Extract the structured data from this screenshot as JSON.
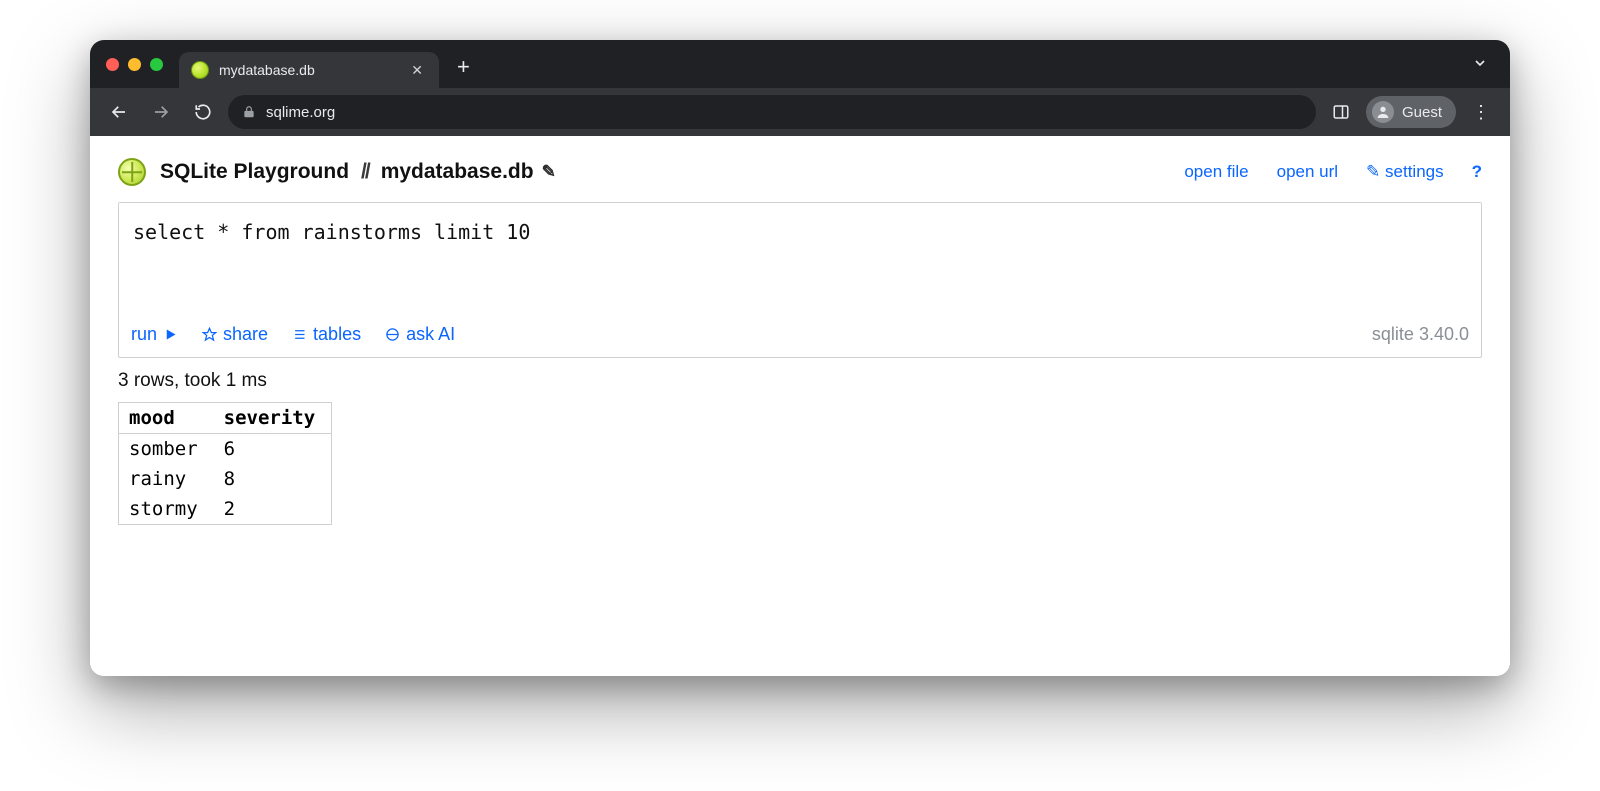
{
  "browser": {
    "tab_title": "mydatabase.db",
    "url": "sqlime.org",
    "profile_label": "Guest"
  },
  "header": {
    "app_title": "SQLite Playground",
    "db_name": "mydatabase.db",
    "links": {
      "open_file": "open file",
      "open_url": "open url",
      "settings": "settings",
      "help": "?"
    }
  },
  "editor": {
    "sql": "select * from rainstorms limit 10",
    "actions": {
      "run": "run",
      "share": "share",
      "tables": "tables",
      "ask_ai": "ask AI"
    },
    "version": "sqlite 3.40.0"
  },
  "result": {
    "status": "3 rows, took 1 ms",
    "columns": [
      "mood",
      "severity"
    ],
    "rows": [
      [
        "somber",
        "6"
      ],
      [
        "rainy",
        "8"
      ],
      [
        "stormy",
        "2"
      ]
    ]
  }
}
